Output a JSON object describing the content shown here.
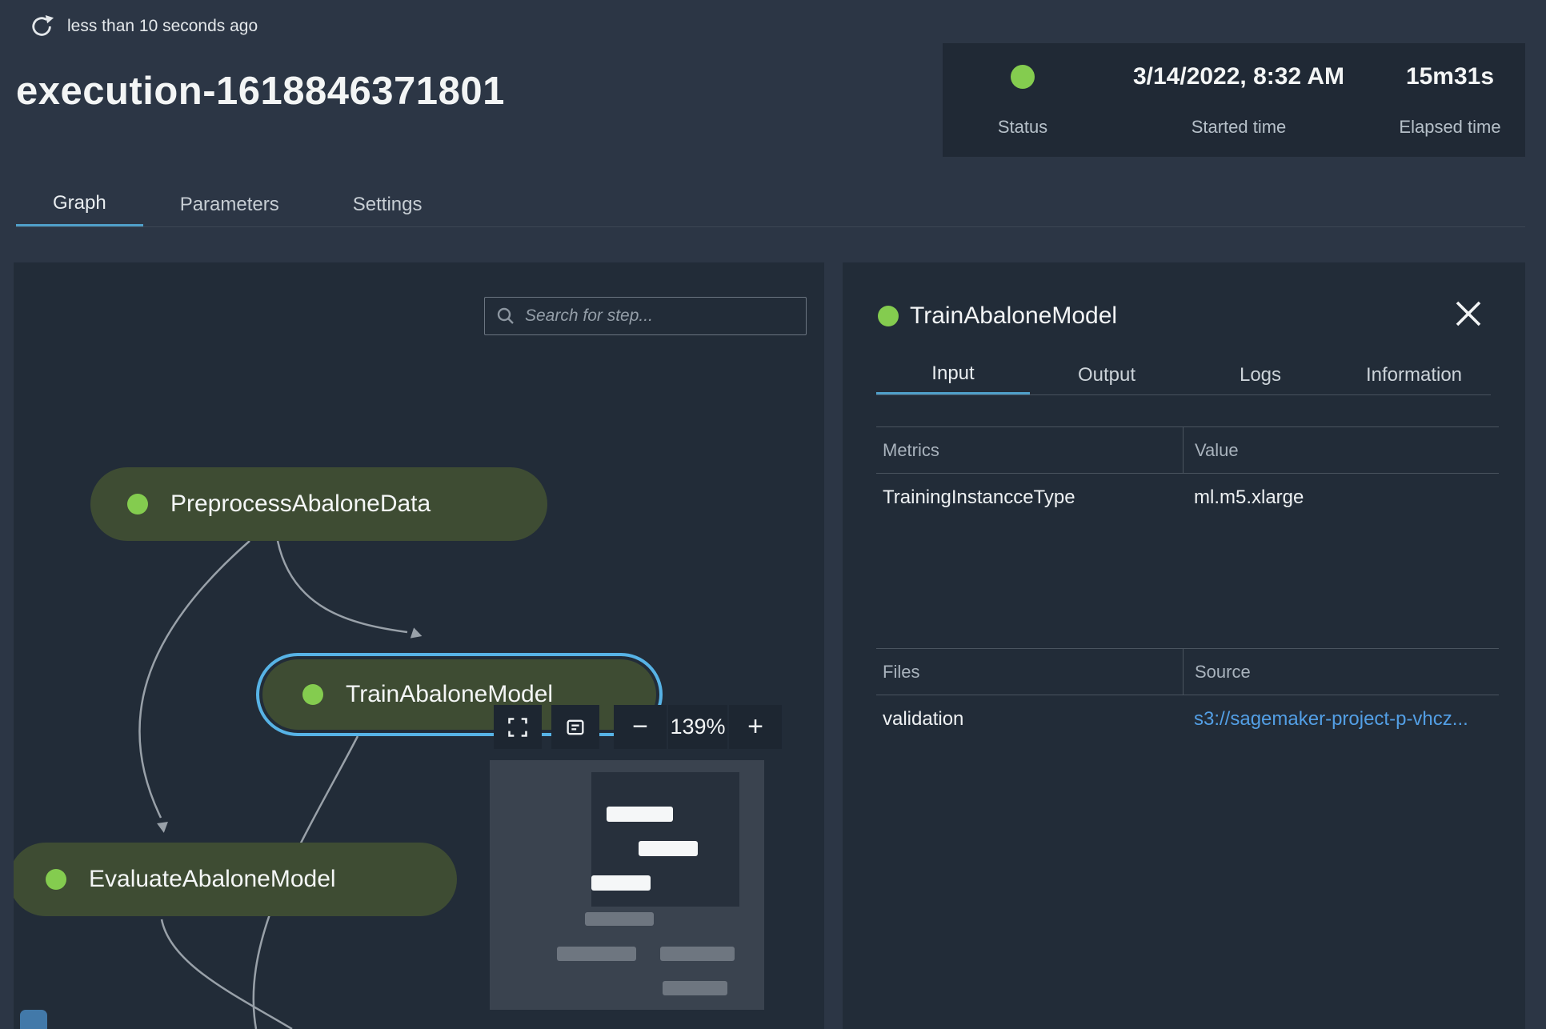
{
  "colors": {
    "accent": "#4f9fc9",
    "success_green": "#84cc4f",
    "link_blue": "#539fe5",
    "node_green": "#3e4c33",
    "selected_border": "#57b3e6",
    "panel_bg": "#222c38",
    "page_bg": "#2c3645"
  },
  "header": {
    "refreshed_text": "less than 10 seconds ago",
    "title": "execution-1618846371801",
    "status_panel": {
      "status_label": "Status",
      "started_label": "Started time",
      "started_value": "3/14/2022, 8:32 AM",
      "elapsed_label": "Elapsed time",
      "elapsed_value": "15m31s"
    },
    "tabs": [
      {
        "label": "Graph"
      },
      {
        "label": "Parameters"
      },
      {
        "label": "Settings"
      }
    ]
  },
  "graph": {
    "search_placeholder": "Search for step...",
    "zoom": {
      "level": "139%",
      "minus": "−",
      "plus": "+"
    },
    "nodes": [
      {
        "label": "PreprocessAbaloneData"
      },
      {
        "label": "TrainAbaloneModel"
      },
      {
        "label": "EvaluateAbaloneModel"
      }
    ]
  },
  "details": {
    "title": "TrainAbaloneModel",
    "tabs": [
      {
        "label": "Input"
      },
      {
        "label": "Output"
      },
      {
        "label": "Logs"
      },
      {
        "label": "Information"
      }
    ],
    "metrics_table": {
      "headers": [
        "Metrics",
        "Value"
      ],
      "rows": [
        [
          "TrainingInstancceType",
          "ml.m5.xlarge"
        ]
      ]
    },
    "files_table": {
      "headers": [
        "Files",
        "Source"
      ],
      "rows": [
        [
          "validation",
          "s3://sagemaker-project-p-vhcz..."
        ]
      ]
    }
  }
}
